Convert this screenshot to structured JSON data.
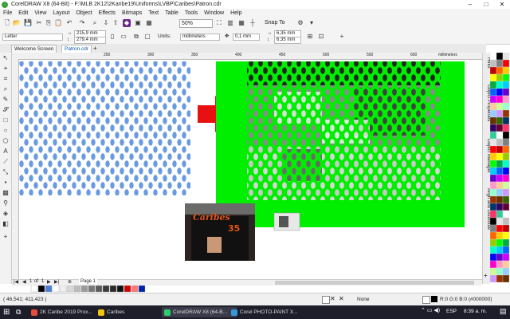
{
  "window": {
    "title": "CorelDRAW X8 (64-Bit) - F:\\MLB 2K12\\2Karibe19\\Uniforms\\LVBP\\Caribes\\Patron.cdr"
  },
  "menu": [
    "File",
    "Edit",
    "View",
    "Layout",
    "Object",
    "Effects",
    "Bitmaps",
    "Text",
    "Table",
    "Tools",
    "Window",
    "Help"
  ],
  "toolbar": {
    "zoom": "50%",
    "snap_to": "Snap To"
  },
  "propbar": {
    "page_preset": "Letter",
    "width": "215,9 mm",
    "height": "279,4 mm",
    "units_label": "Units:",
    "units_value": "millimeters",
    "nudge": "0,1 mm",
    "dup_x": "6,35 mm",
    "dup_y": "6,35 mm"
  },
  "tabs": {
    "welcome": "Welcome Screen",
    "doc": "Patron.cdr"
  },
  "ruler": {
    "h_ticks": [
      "250",
      "300",
      "350",
      "400",
      "450",
      "500",
      "550",
      "600",
      "650"
    ],
    "units": "millimeters"
  },
  "dockers": [
    "Hints",
    "Object Properties",
    "Object Manager",
    "Align and Distribute"
  ],
  "page_nav": {
    "current": "1",
    "of_label": "of",
    "total": "1",
    "page_label": "Page 1"
  },
  "status": {
    "coords": "( 46,541; 411,423 )",
    "fill_none": "None",
    "color_info": "R:0 G:0 B:0 (#000000)"
  },
  "taskbar": {
    "items": [
      "2K Caribe 2019 Prox...",
      "Caribes",
      "CorelDRAW X8 (64-B...",
      "Corel PHOTO-PAINT X..."
    ],
    "lang": "ESP",
    "time": "8:39 a. m."
  },
  "photo": {
    "jersey_text": "Caribes",
    "number": "35"
  },
  "colors": {
    "pattern_blue": "#6a9be0",
    "green_bg": "#00ef00",
    "arrow_red": "#e81010"
  }
}
